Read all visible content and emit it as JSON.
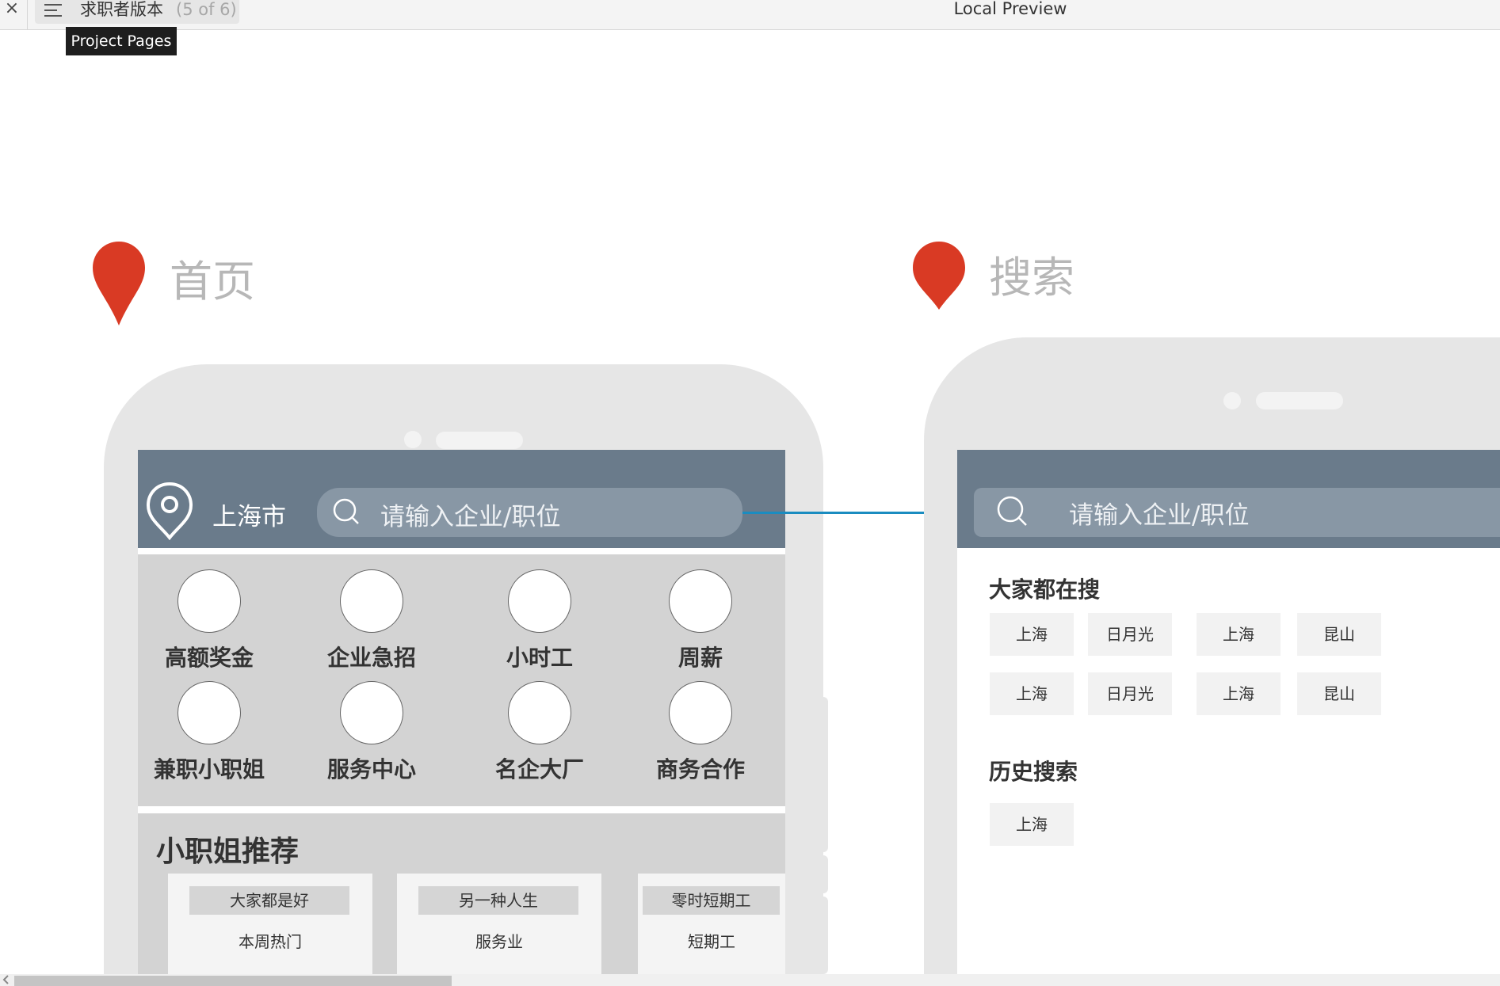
{
  "top_bar": {
    "close_label": "×",
    "page_name": "求职者版本",
    "page_count": "(5 of 6)",
    "window_title": "Local Preview",
    "tooltip": "Project Pages"
  },
  "colors": {
    "pin_red": "#d93a24",
    "header_slate": "#6a7b8b",
    "connector_blue": "#1a8cc0"
  },
  "home_section": {
    "title": "首页",
    "city": "上海市",
    "search_placeholder": "请输入企业/职位",
    "categories": [
      {
        "label": "高额奖金"
      },
      {
        "label": "企业急招"
      },
      {
        "label": "小时工"
      },
      {
        "label": "周薪"
      },
      {
        "label": "兼职小职姐"
      },
      {
        "label": "服务中心"
      },
      {
        "label": "名企大厂"
      },
      {
        "label": "商务合作"
      }
    ],
    "recommend_title": "小职姐推荐",
    "recommend_cards": [
      {
        "tag": "大家都是好",
        "sub": "本周热门"
      },
      {
        "tag": "另一种人生",
        "sub": "服务业"
      },
      {
        "tag": "零时短期工",
        "sub": "短期工"
      }
    ]
  },
  "search_section": {
    "title": "搜索",
    "search_placeholder": "请输入企业/职位",
    "popular_heading": "大家都在搜",
    "popular_chips": [
      "上海",
      "日月光",
      "上海",
      "昆山",
      "上海",
      "日月光",
      "上海",
      "昆山"
    ],
    "history_heading": "历史搜索",
    "history_chips": [
      "上海"
    ]
  }
}
